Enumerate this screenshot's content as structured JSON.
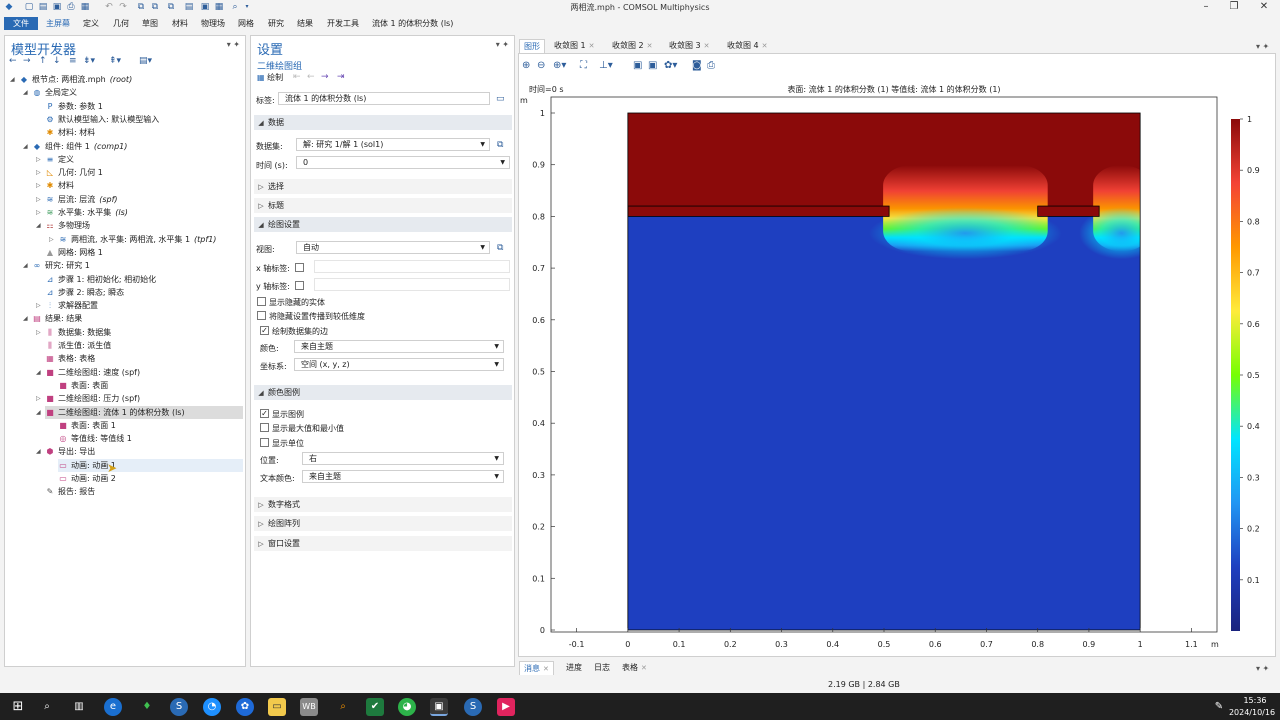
{
  "window": {
    "title": "两相流.mph - COMSOL Multiphysics"
  },
  "menu": {
    "items": [
      "文件",
      "主屏幕",
      "定义",
      "几何",
      "草图",
      "材料",
      "物理场",
      "网格",
      "研究",
      "结果",
      "开发工具",
      "流体 1 的体积分数 (ls)"
    ]
  },
  "model_builder": {
    "title": "模型开发器",
    "tree": [
      {
        "text": "根节点: 两相流.mph",
        "tag": "(root)",
        "icon": "◆",
        "color": "#2a6ab4",
        "depth": 0,
        "toggle": "◢"
      },
      {
        "text": "全局定义",
        "tag": "",
        "icon": "◍",
        "color": "#2a6ab4",
        "depth": 1,
        "toggle": "◢"
      },
      {
        "text": "参数: 参数 1",
        "tag": "",
        "icon": "P",
        "color": "#2a6ab4",
        "depth": 2,
        "toggle": ""
      },
      {
        "text": "默认模型输入: 默认模型输入",
        "tag": "",
        "icon": "⚙",
        "color": "#2a6ab4",
        "depth": 2,
        "toggle": ""
      },
      {
        "text": "材料: 材料",
        "tag": "",
        "icon": "✱",
        "color": "#e08a00",
        "depth": 2,
        "toggle": ""
      },
      {
        "text": "组件: 组件 1",
        "tag": "(comp1)",
        "icon": "◆",
        "color": "#2a6ab4",
        "depth": 1,
        "toggle": "◢"
      },
      {
        "text": "定义",
        "tag": "",
        "icon": "≡",
        "color": "#2a6ab4",
        "depth": 2,
        "toggle": "▷"
      },
      {
        "text": "几何: 几何 1",
        "tag": "",
        "icon": "◺",
        "color": "#e08a00",
        "depth": 2,
        "toggle": "▷"
      },
      {
        "text": "材料",
        "tag": "",
        "icon": "✱",
        "color": "#e08a00",
        "depth": 2,
        "toggle": "▷"
      },
      {
        "text": "层流: 层流",
        "tag": "(spf)",
        "icon": "≋",
        "color": "#2a6ab4",
        "depth": 2,
        "toggle": "▷"
      },
      {
        "text": "水平集: 水平集",
        "tag": "(ls)",
        "icon": "≋",
        "color": "#3a9a5a",
        "depth": 2,
        "toggle": "▷"
      },
      {
        "text": "多物理场",
        "tag": "",
        "icon": "⚏",
        "color": "#b03a3a",
        "depth": 2,
        "toggle": "◢"
      },
      {
        "text": "两相流, 水平集: 两相流, 水平集 1",
        "tag": "(tpf1)",
        "icon": "≋",
        "color": "#2a6ab4",
        "depth": 3,
        "toggle": "▷"
      },
      {
        "text": "网格: 网格 1",
        "tag": "",
        "icon": "▲",
        "color": "#999999",
        "depth": 2,
        "toggle": ""
      },
      {
        "text": "研究: 研究 1",
        "tag": "",
        "icon": "∞",
        "color": "#2a6ab4",
        "depth": 1,
        "toggle": "◢"
      },
      {
        "text": "步骤 1: 相初始化; 相初始化",
        "tag": "",
        "icon": "⊿",
        "color": "#2a6ab4",
        "depth": 2,
        "toggle": ""
      },
      {
        "text": "步骤 2: 瞬态; 瞬态",
        "tag": "",
        "icon": "⊿",
        "color": "#2a6ab4",
        "depth": 2,
        "toggle": ""
      },
      {
        "text": "求解器配置",
        "tag": "",
        "icon": "⫶",
        "color": "#2a6ab4",
        "depth": 2,
        "toggle": "▷"
      },
      {
        "text": "结果: 结果",
        "tag": "",
        "icon": "▤",
        "color": "#c04080",
        "depth": 1,
        "toggle": "◢"
      },
      {
        "text": "数据集: 数据集",
        "tag": "",
        "icon": "⫼",
        "color": "#c04080",
        "depth": 2,
        "toggle": "▷"
      },
      {
        "text": "派生值: 派生值",
        "tag": "",
        "icon": "⫼",
        "color": "#c04080",
        "depth": 2,
        "toggle": ""
      },
      {
        "text": "表格: 表格",
        "tag": "",
        "icon": "▦",
        "color": "#c04080",
        "depth": 2,
        "toggle": ""
      },
      {
        "text": "二维绘图组: 速度 (spf)",
        "tag": "",
        "icon": "■",
        "color": "#c04080",
        "depth": 2,
        "toggle": "◢"
      },
      {
        "text": "表面: 表面",
        "tag": "",
        "icon": "■",
        "color": "#c04080",
        "depth": 3,
        "toggle": ""
      },
      {
        "text": "二维绘图组: 压力 (spf)",
        "tag": "",
        "icon": "■",
        "color": "#c04080",
        "depth": 2,
        "toggle": "▷"
      },
      {
        "text": "二维绘图组: 流体 1 的体积分数 (ls)",
        "tag": "",
        "icon": "■",
        "color": "#c04080",
        "depth": 2,
        "toggle": "◢"
      },
      {
        "text": "表面: 表面 1",
        "tag": "",
        "icon": "■",
        "color": "#c04080",
        "depth": 3,
        "toggle": ""
      },
      {
        "text": "等值线: 等值线 1",
        "tag": "",
        "icon": "◎",
        "color": "#c04080",
        "depth": 3,
        "toggle": ""
      },
      {
        "text": "导出: 导出",
        "tag": "",
        "icon": "⬢",
        "color": "#c04080",
        "depth": 2,
        "toggle": "◢"
      },
      {
        "text": "动画: 动画 1",
        "tag": "",
        "icon": "▭",
        "color": "#c04080",
        "depth": 3,
        "toggle": ""
      },
      {
        "text": "动画: 动画 2",
        "tag": "",
        "icon": "▭",
        "color": "#c04080",
        "depth": 3,
        "toggle": ""
      },
      {
        "text": "报告: 报告",
        "tag": "",
        "icon": "✎",
        "color": "#555555",
        "depth": 2,
        "toggle": ""
      }
    ]
  },
  "settings": {
    "title": "设置",
    "subtitle": "二维绘图组",
    "plot_button": "绘制",
    "label_caption": "标签:",
    "label_value": "流体 1 的体积分数 (ls)",
    "sec_data": "数据",
    "dataset_label": "数据集:",
    "dataset_value": "解: 研究 1/解 1 (sol1)",
    "time_label": "时间 (s):",
    "time_value": "0",
    "sec_selection": "选择",
    "sec_title": "标题",
    "sec_plot_settings": "绘图设置",
    "view_label": "视图:",
    "view_value": "自动",
    "xaxis_label": "x 轴标签:",
    "yaxis_label": "y 轴标签:",
    "show_hidden": "显示隐藏的实体",
    "propagate_hiding": "将隐藏设置传播到较低维度",
    "plot_edges": "绘制数据集的边",
    "color_label": "颜色:",
    "color_value": "来自主题",
    "frame_label": "坐标系:",
    "frame_value": "空间 (x, y, z)",
    "sec_legend": "颜色图例",
    "show_legend": "显示图例",
    "show_maxmin": "显示最大值和最小值",
    "show_units": "显示单位",
    "position_label": "位置:",
    "position_value": "右",
    "textcolor_label": "文本颜色:",
    "textcolor_value": "来自主题",
    "sec_number_format": "数字格式",
    "sec_plot_array": "绘图阵列",
    "sec_window": "窗口设置"
  },
  "graphics": {
    "tabs": [
      "图形",
      "收敛图 1",
      "收敛图 2",
      "收敛图 3",
      "收敛图 4"
    ],
    "time_text": "时间=0 s",
    "caption": "表面: 流体 1 的体积分数 (1)  等值线: 流体 1 的体积分数 (1)",
    "unit_y": "m",
    "unit_x": "m",
    "bottom_tabs": [
      "消息",
      "进度",
      "日志",
      "表格"
    ]
  },
  "chart_data": {
    "type": "heatmap",
    "xlim": [
      -0.15,
      1.15
    ],
    "ylim": [
      0,
      1
    ],
    "xticks": [
      "-0.1",
      "0",
      "0.1",
      "0.2",
      "0.3",
      "0.4",
      "0.5",
      "0.6",
      "0.7",
      "0.8",
      "0.9",
      "1",
      "1.1"
    ],
    "yticks": [
      "0",
      "0.1",
      "0.2",
      "0.3",
      "0.4",
      "0.5",
      "0.6",
      "0.7",
      "0.8",
      "0.9",
      "1"
    ],
    "colorbar_ticks": [
      "1",
      "0.9",
      "0.8",
      "0.7",
      "0.6",
      "0.5",
      "0.4",
      "0.3",
      "0.2",
      "0.1"
    ],
    "domain": {
      "x": [
        0,
        1
      ],
      "y": [
        0,
        1
      ]
    },
    "interface_y": 0.81,
    "obstacles": [
      {
        "x": [
          0,
          0.51
        ],
        "y": [
          0.8,
          0.82
        ]
      },
      {
        "x": [
          0.8,
          0.92
        ],
        "y": [
          0.8,
          0.82
        ]
      }
    ],
    "colormap": [
      "#1a237e",
      "#1e3fc0",
      "#2196f3",
      "#00e5ff",
      "#76ff03",
      "#ffeb3b",
      "#ff9800",
      "#f44336",
      "#8b0a0a"
    ]
  },
  "status": {
    "memory": "2.19 GB | 2.84 GB"
  },
  "taskbar": {
    "time": "15:36",
    "date": "2024/10/16"
  }
}
